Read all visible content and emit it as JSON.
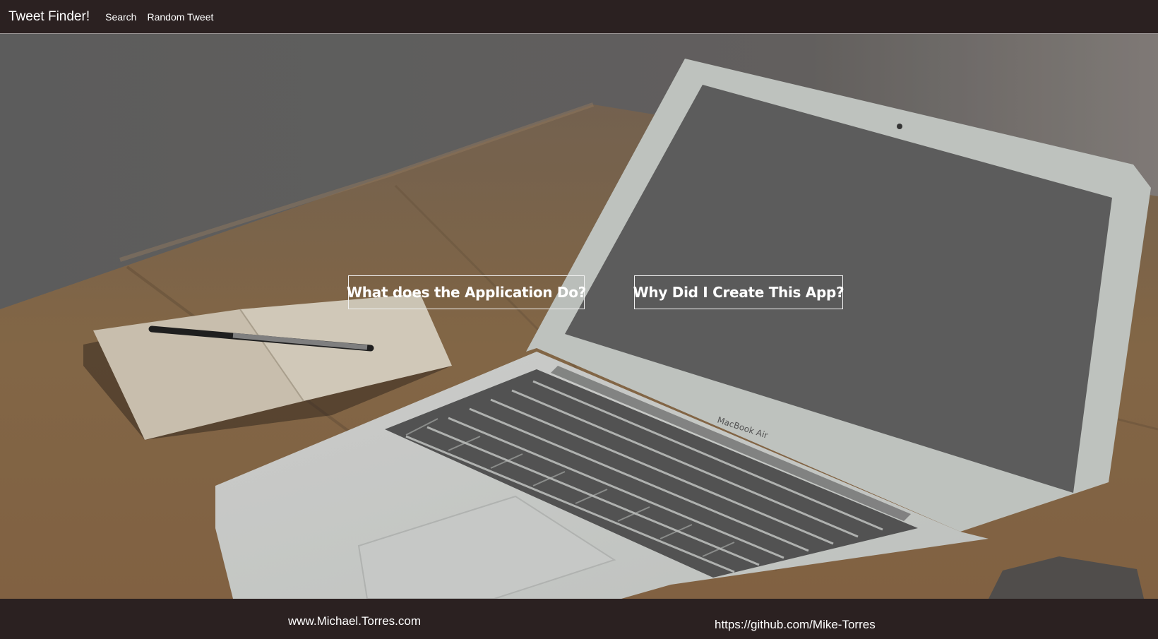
{
  "navbar": {
    "brand": "Tweet Finder!",
    "links": [
      "Search",
      "Random Tweet"
    ]
  },
  "hero": {
    "buttons": {
      "what": "What does the Application Do?",
      "why": "Why Did I Create This App?"
    },
    "laptop_label": "MacBook Air"
  },
  "footer": {
    "website": "www.Michael.Torres.com",
    "github": "https://github.com/Mike-Torres"
  },
  "colors": {
    "bar": "#2b2121",
    "overlay": "#666666",
    "text": "#ffffff"
  }
}
